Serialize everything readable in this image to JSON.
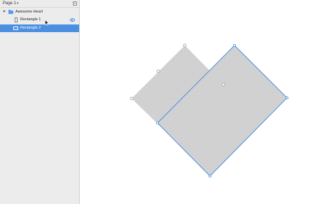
{
  "page_selector": {
    "label": "Page 1"
  },
  "layers": {
    "group": {
      "name": "Awesome Heart"
    },
    "items": [
      {
        "name": "Rectangle 1",
        "selected": false,
        "visible": true
      },
      {
        "name": "Rectangle 2",
        "selected": true
      }
    ]
  },
  "colors": {
    "selection": "#4a8fe0",
    "shape_fill": "#d2d2d2",
    "sidebar_bg": "#ececec"
  },
  "icons": {
    "page_chevron": "chevron-down-icon",
    "add_page": "add-page-icon",
    "group": "folder-icon",
    "layer": "rectangle-icon",
    "visibility": "eye-icon"
  }
}
